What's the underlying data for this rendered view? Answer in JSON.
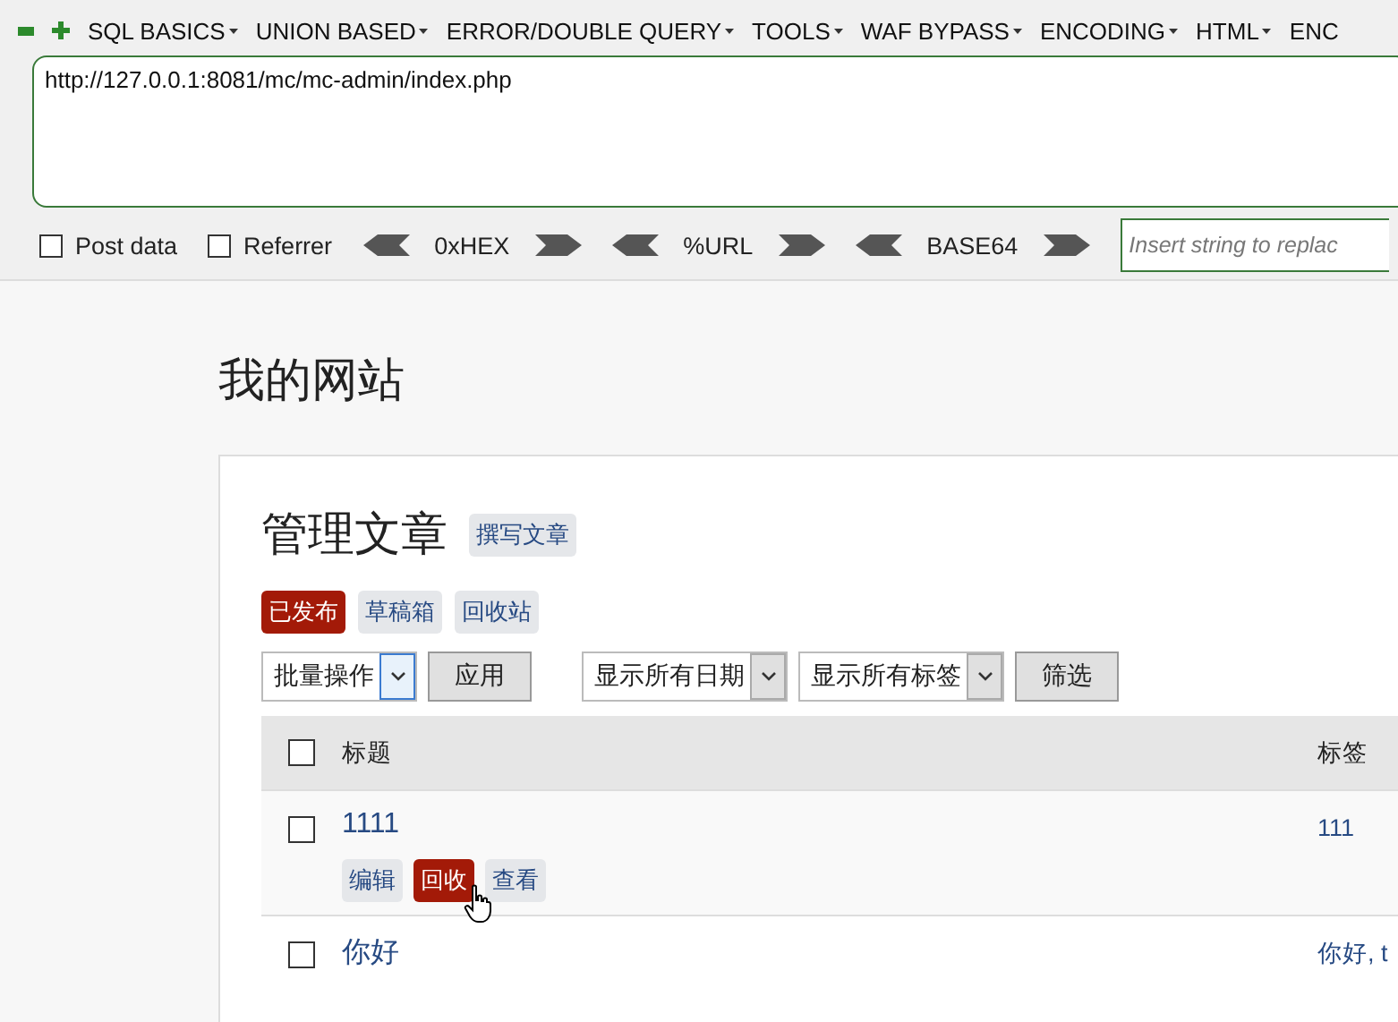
{
  "toolbar": {
    "menus": [
      "SQL BASICS",
      "UNION BASED",
      "ERROR/DOUBLE QUERY",
      "TOOLS",
      "WAF BYPASS",
      "ENCODING",
      "HTML",
      "ENC"
    ]
  },
  "url_field": {
    "value": "http://127.0.0.1:8081/mc/mc-admin/index.php"
  },
  "options": [
    {
      "label": "Post data",
      "checked": false
    },
    {
      "label": "Referrer",
      "checked": false
    }
  ],
  "encoders": [
    "0xHEX",
    "%URL",
    "BASE64"
  ],
  "replace_field": {
    "placeholder": "Insert string to replac"
  },
  "site_title": "我的网站",
  "panel": {
    "heading": "管理文章",
    "new_post": "撰写文章",
    "status_tabs": [
      {
        "label": "已发布",
        "selected": true
      },
      {
        "label": "草稿箱",
        "selected": false
      },
      {
        "label": "回收站",
        "selected": false
      }
    ],
    "filters": [
      {
        "kind": "select",
        "value": "批量操作",
        "focused": true
      },
      {
        "kind": "button",
        "label": "应用"
      },
      {
        "kind": "select",
        "value": "显示所有日期",
        "focused": false
      },
      {
        "kind": "select",
        "value": "显示所有标签",
        "focused": false
      },
      {
        "kind": "button",
        "label": "筛选"
      }
    ],
    "table": {
      "select_all_checked": false,
      "columns": [
        "标题",
        "标签"
      ],
      "rows": [
        {
          "title": "1111",
          "tags": "111",
          "checked": false,
          "actions": [
            {
              "label": "编辑",
              "highlighted": false
            },
            {
              "label": "回收",
              "highlighted": true
            },
            {
              "label": "查看",
              "highlighted": false
            }
          ]
        },
        {
          "title": "你好",
          "tags": "你好, t",
          "checked": false
        }
      ]
    }
  }
}
